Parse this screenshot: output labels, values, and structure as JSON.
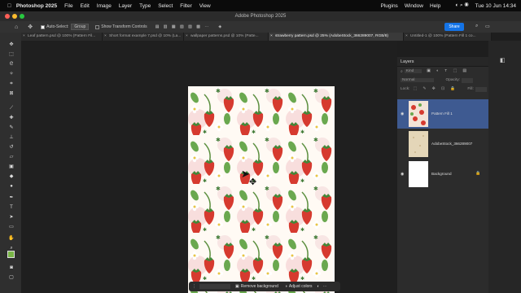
{
  "menubar": {
    "app_name": "Photoshop 2025",
    "items": [
      "File",
      "Edit",
      "Image",
      "Layer",
      "Type",
      "Select",
      "Filter",
      "View"
    ],
    "right_items": [
      "Plugins",
      "Window",
      "Help"
    ],
    "clock": "Tue 10 Jun  14:34"
  },
  "window": {
    "title": "Adobe Photoshop 2025"
  },
  "options": {
    "auto_select_label": "Auto-Select:",
    "auto_select_value": "Group",
    "transform_label": "Show Transform Controls",
    "share_label": "Share"
  },
  "tabs": [
    {
      "label": "Leaf pattern.psd @ 100% (Pattern Fil...",
      "active": false
    },
    {
      "label": "Short format example 7.psd @ 10% (La...",
      "active": false
    },
    {
      "label": "wallpaper patterns.psd @ 10% (Patte...",
      "active": false
    },
    {
      "label": "strawberry pattern.psd @ 25% (AdobeStock_366289007, RGB/8)",
      "active": true
    },
    {
      "label": "Untitled-1 @ 100% (Pattern Fill 1 co...",
      "active": false
    }
  ],
  "tools": [
    "move-icon",
    "marquee-icon",
    "lasso-icon",
    "magic-wand-icon",
    "crop-icon",
    "frame-icon",
    "eyedropper-icon",
    "healing-icon",
    "brush-icon",
    "stamp-icon",
    "history-brush-icon",
    "eraser-icon",
    "gradient-icon",
    "blur-icon",
    "dodge-icon",
    "pen-icon",
    "type-icon",
    "path-select-icon",
    "rectangle-icon",
    "hand-icon",
    "zoom-icon"
  ],
  "colors": {
    "foreground": "#7ab648",
    "background": "#ffffff",
    "accent": "#1473e6",
    "layer_selected": "#3e5a91"
  },
  "contextbar": {
    "remove_bg": "Remove background",
    "adjust_colors": "Adjust colors"
  },
  "layers_panel": {
    "tab_label": "Layers",
    "kind_label": "Kind",
    "mode_label": "Normal",
    "opacity_label": "Opacity:",
    "lock_label": "Lock:",
    "fill_label": "Fill:",
    "layers": [
      {
        "name": "Pattern Fill 1",
        "selected": true,
        "visible": true
      },
      {
        "name": "AdobeStock_366289007",
        "selected": false,
        "visible": false
      },
      {
        "name": "Background",
        "selected": false,
        "visible": true
      }
    ]
  }
}
